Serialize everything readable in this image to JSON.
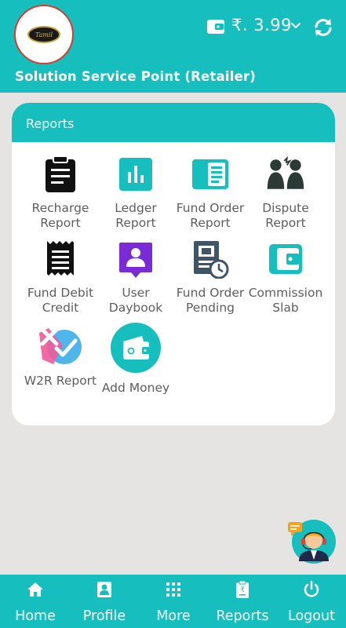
{
  "header": {
    "balance": "₹. 3.99",
    "shop_name": "Solution Service Point (Retailer)",
    "logo_text": "Tamil"
  },
  "reports_card": {
    "title": "Reports",
    "items": [
      {
        "label": "Recharge Report",
        "icon": "clipboard-icon"
      },
      {
        "label": "Ledger Report",
        "icon": "bar-chart-icon"
      },
      {
        "label": "Fund Order Report",
        "icon": "wallet-document-icon"
      },
      {
        "label": "Dispute Report",
        "icon": "people-dispute-icon"
      },
      {
        "label": "Fund Debit Credit",
        "icon": "receipt-icon"
      },
      {
        "label": "User Daybook",
        "icon": "user-badge-icon"
      },
      {
        "label": "Fund Order Pending",
        "icon": "document-clock-icon"
      },
      {
        "label": "Commission Slab",
        "icon": "wallet-icon"
      },
      {
        "label": "W2R Report",
        "icon": "check-cross-icon"
      },
      {
        "label": "Add Money",
        "icon": "add-money-wallet-icon"
      }
    ]
  },
  "bottom_nav": [
    {
      "label": "Home",
      "icon": "home-icon"
    },
    {
      "label": "Profile",
      "icon": "profile-icon"
    },
    {
      "label": "More",
      "icon": "grid-icon"
    },
    {
      "label": "Reports",
      "icon": "report-icon"
    },
    {
      "label": "Logout",
      "icon": "power-icon"
    }
  ],
  "colors": {
    "primary": "#16bfbd",
    "background": "#e6e4e3",
    "label": "#5e5e5e",
    "icon_dark": "#111111",
    "icon_purple": "#7b2bd6",
    "icon_pink": "#ef5a9a"
  }
}
